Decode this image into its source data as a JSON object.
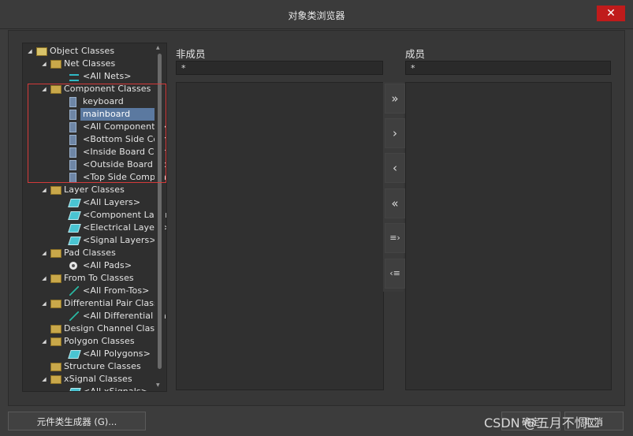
{
  "window": {
    "title": "对象类浏览器",
    "close_label": "✕"
  },
  "tree": {
    "rows": [
      {
        "label": "Object Classes",
        "arrow": "◢",
        "icon": "root-folder-icon",
        "level": 0
      },
      {
        "label": "Net Classes",
        "arrow": "◢",
        "icon": "folder-icon",
        "level": 1
      },
      {
        "label": "<All Nets>",
        "arrow": "",
        "icon": "net-icon",
        "level": 2
      },
      {
        "label": "Component Classes",
        "arrow": "◢",
        "icon": "folder-icon",
        "level": 1
      },
      {
        "label": "keyboard",
        "arrow": "",
        "icon": "component-icon",
        "level": 2
      },
      {
        "label": "mainboard",
        "arrow": "",
        "icon": "component-icon",
        "level": 2,
        "selected": true
      },
      {
        "label": "<All Components>",
        "arrow": "",
        "icon": "component-icon",
        "level": 2
      },
      {
        "label": "<Bottom Side Comp",
        "arrow": "",
        "icon": "component-icon",
        "level": 2
      },
      {
        "label": "<Inside Board Com",
        "arrow": "",
        "icon": "component-icon",
        "level": 2
      },
      {
        "label": "<Outside Board Co",
        "arrow": "",
        "icon": "component-icon",
        "level": 2
      },
      {
        "label": "<Top Side Compon",
        "arrow": "",
        "icon": "component-icon",
        "level": 2
      },
      {
        "label": "Layer Classes",
        "arrow": "◢",
        "icon": "folder-icon",
        "level": 1
      },
      {
        "label": "<All Layers>",
        "arrow": "",
        "icon": "layer-icon",
        "level": 2
      },
      {
        "label": "<Component Layer",
        "arrow": "",
        "icon": "layer-icon",
        "level": 2
      },
      {
        "label": "<Electrical Layers>",
        "arrow": "",
        "icon": "layer-icon",
        "level": 2
      },
      {
        "label": "<Signal Layers>",
        "arrow": "",
        "icon": "layer-icon",
        "level": 2
      },
      {
        "label": "Pad Classes",
        "arrow": "◢",
        "icon": "folder-icon",
        "level": 1
      },
      {
        "label": "<All Pads>",
        "arrow": "",
        "icon": "pad-icon",
        "level": 2
      },
      {
        "label": "From To Classes",
        "arrow": "◢",
        "icon": "folder-icon",
        "level": 1
      },
      {
        "label": "<All From-Tos>",
        "arrow": "",
        "icon": "from-to-icon",
        "level": 2
      },
      {
        "label": "Differential Pair Classe",
        "arrow": "◢",
        "icon": "folder-icon",
        "level": 1
      },
      {
        "label": "<All Differential Pai",
        "arrow": "",
        "icon": "from-to-icon",
        "level": 2
      },
      {
        "label": "Design Channel Classe",
        "arrow": "",
        "icon": "folder-icon",
        "level": 1
      },
      {
        "label": "Polygon Classes",
        "arrow": "◢",
        "icon": "folder-icon",
        "level": 1
      },
      {
        "label": "<All Polygons>",
        "arrow": "",
        "icon": "polygon-icon",
        "level": 2
      },
      {
        "label": "Structure Classes",
        "arrow": "",
        "icon": "folder-icon",
        "level": 1
      },
      {
        "label": "xSignal Classes",
        "arrow": "◢",
        "icon": "folder-icon",
        "level": 1
      },
      {
        "label": "<All xSignals>",
        "arrow": "",
        "icon": "layer-icon",
        "level": 2
      }
    ]
  },
  "non_members": {
    "header": "非成员",
    "filter_value": "*"
  },
  "members": {
    "header": "成员",
    "filter_value": "*"
  },
  "move_buttons": {
    "add_all": "»",
    "add": "›",
    "remove": "‹",
    "remove_all": "«",
    "add_selected_list": "≡›",
    "remove_selected_list": "‹≡"
  },
  "footer": {
    "class_generator_label": "元件类生成器 (G)...",
    "ok_label": "确定",
    "cancel_label": "取消"
  },
  "watermark": "CSDN @五月不惆二"
}
